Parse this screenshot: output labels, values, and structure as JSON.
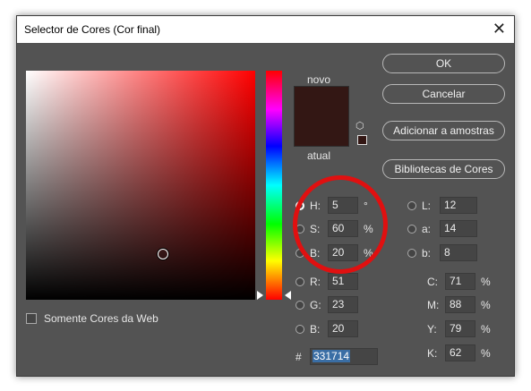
{
  "window": {
    "title": "Selector de Cores (Cor final)",
    "close_glyph": "✕"
  },
  "web_only": {
    "label": "Somente Cores da Web",
    "checked": false
  },
  "preview": {
    "new_label": "novo",
    "current_label": "atual",
    "new_color": "#331714",
    "current_color": "#331714"
  },
  "buttons": {
    "ok": "OK",
    "cancel": "Cancelar",
    "add_to_swatches": "Adicionar a amostras",
    "color_libraries": "Bibliotecas de Cores"
  },
  "hsb": {
    "h": {
      "label": "H:",
      "value": "5",
      "unit": "°",
      "selected": true
    },
    "s": {
      "label": "S:",
      "value": "60",
      "unit": "%"
    },
    "b": {
      "label": "B:",
      "value": "20",
      "unit": "%"
    }
  },
  "rgb": {
    "r": {
      "label": "R:",
      "value": "51"
    },
    "g": {
      "label": "G:",
      "value": "23"
    },
    "b": {
      "label": "B:",
      "value": "20"
    }
  },
  "lab": {
    "l": {
      "label": "L:",
      "value": "12"
    },
    "a": {
      "label": "a:",
      "value": "14"
    },
    "b": {
      "label": "b:",
      "value": "8"
    }
  },
  "cmyk": {
    "c": {
      "label": "C:",
      "value": "71",
      "unit": "%"
    },
    "m": {
      "label": "M:",
      "value": "88",
      "unit": "%"
    },
    "y": {
      "label": "Y:",
      "value": "79",
      "unit": "%"
    },
    "k": {
      "label": "K:",
      "value": "62",
      "unit": "%"
    }
  },
  "hex": {
    "hash": "#",
    "value": "331714"
  },
  "icons": {
    "gamut_warning": "cube-icon"
  },
  "colors": {
    "dialog_bg": "#535353",
    "annotation": "#e01010",
    "hex_selection": "#3a6ea5"
  }
}
